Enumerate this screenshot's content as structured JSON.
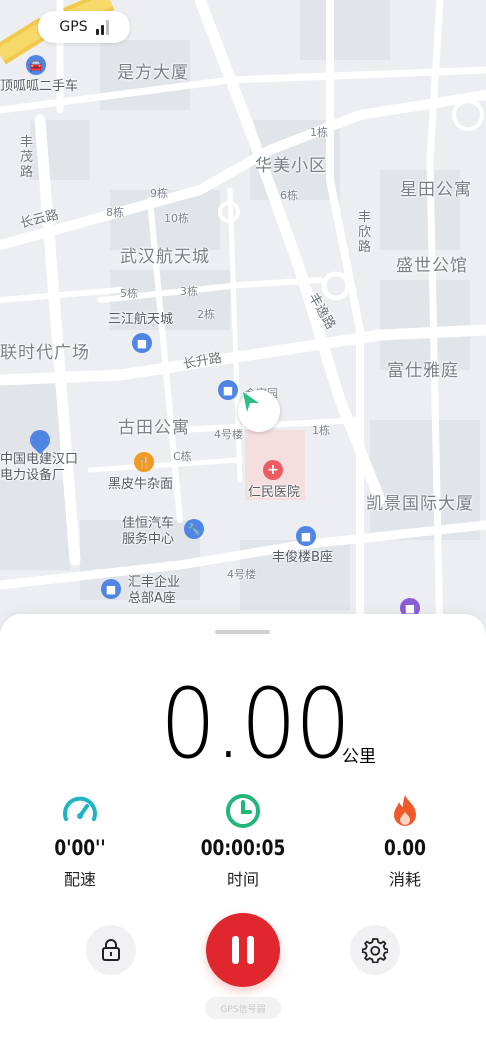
{
  "gps": {
    "label": "GPS",
    "signal_bars": 2
  },
  "map": {
    "labels": {
      "shifang": "是方大厦",
      "guaguaer": "顶呱呱二手车",
      "fengmao_road": "丰茂路",
      "changyun_road": "长云路",
      "huamei": "华美小区",
      "xingtian": "星田公寓",
      "fengxin_road": "丰欣路",
      "wuhan_hangtian": "武汉航天城",
      "shengshi": "盛世公馆",
      "sanjiang": "三江航天城",
      "shidai": "联时代广场",
      "fengyi_road": "丰逸路",
      "fushi": "富仕雅庭",
      "changsheng_road": "长升路",
      "jinjiayuan": "金家园",
      "gutian": "古田公寓",
      "zhongguo_dianjian": "中国电建汉口\n电力设备厂",
      "heipiniu": "黑皮牛杂面",
      "renmin": "仁民医院",
      "kaijing": "凯景国际大厦",
      "jiaheng": "佳恒汽车\n服务中心",
      "fengjun": "丰俊楼B座",
      "huifeng": "汇丰企业\n总部A座",
      "b1": "1栋",
      "b6": "6栋",
      "b9": "9栋",
      "b8": "8栋",
      "b10": "10栋",
      "b5": "5栋",
      "b3": "3栋",
      "b2": "2栋",
      "b4": "4号楼",
      "b1b": "1栋",
      "bc": "C栋",
      "b4b": "4号楼"
    }
  },
  "workout": {
    "distance": "0.00",
    "distance_unit": "公里",
    "pace": {
      "value": "0'00''",
      "label": "配速",
      "icon": "speedometer-icon"
    },
    "time": {
      "value": "00:00:05",
      "label": "时间",
      "icon": "clock-icon"
    },
    "calories": {
      "value": "0.00",
      "label": "消耗",
      "icon": "flame-icon"
    }
  },
  "controls": {
    "lock_icon": "lock-icon",
    "pause_icon": "pause-icon",
    "settings_icon": "gear-icon",
    "bottom_chip": "GPS信号弱"
  },
  "colors": {
    "pace_icon": "#1fb3c6",
    "time_icon": "#23b67a",
    "calorie_icon": "#ef5a2a",
    "pause_button": "#e0272d",
    "location_arrow": "#2bbf86"
  }
}
